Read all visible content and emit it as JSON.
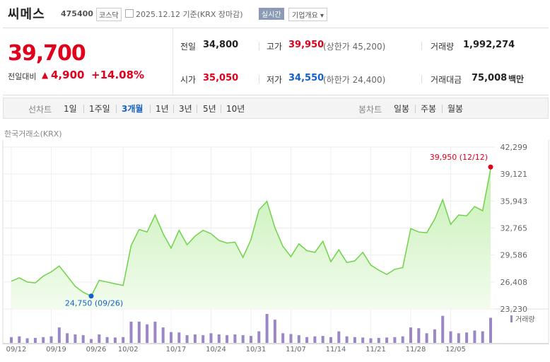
{
  "header": {
    "name": "씨메스",
    "code": "475400",
    "market": "코스닥",
    "date": "2025.12.12 기준(KRX 장마감)",
    "realtime": "실시간",
    "company_overview": "기업개요 ▾"
  },
  "quote": {
    "price": "39,700",
    "change_label": "전일대비",
    "change_arrow": "▲",
    "change": "4,900",
    "change_pct": "+14.08%",
    "prev_label": "전일",
    "prev": "34,800",
    "high_label": "고가",
    "high": "39,950",
    "upper_limit": "(상한가 45,200)",
    "volume_label": "거래량",
    "volume": "1,992,274",
    "open_label": "시가",
    "open": "35,050",
    "low_label": "저가",
    "low": "34,550",
    "lower_limit": "(하한가 24,400)",
    "amount_label": "거래대금",
    "amount": "75,008",
    "amount_unit": "백만"
  },
  "periods": {
    "line_label": "선차트",
    "line_items": [
      "1일",
      "1주일",
      "3개월",
      "1년",
      "3년",
      "5년",
      "10년"
    ],
    "active_index": 2,
    "candle_label": "봉차트",
    "candle_items": [
      "일봉",
      "주봉",
      "월봉"
    ]
  },
  "chart_label": "한국거래소(KRX)",
  "chart_data": {
    "type": "area",
    "y_ticks": [
      "42,299",
      "39,121",
      "35,943",
      "32,765",
      "29,586",
      "26,408",
      "23,230"
    ],
    "ylim": [
      23230,
      42299
    ],
    "x_ticks": [
      "09/12",
      "09/19",
      "09/26",
      "10/02",
      "10/17",
      "10/24",
      "10/31",
      "11/07",
      "11/14",
      "11/21",
      "11/28",
      "12/05"
    ],
    "price_values": [
      26500,
      26900,
      26400,
      26300,
      27100,
      27600,
      28300,
      27100,
      25900,
      25200,
      24750,
      26600,
      26400,
      26200,
      26000,
      30700,
      32600,
      32300,
      34300,
      32100,
      30400,
      32500,
      30800,
      31800,
      32500,
      32100,
      31300,
      31000,
      31100,
      29300,
      31400,
      34900,
      35900,
      32800,
      30600,
      29400,
      30900,
      30100,
      29900,
      31200,
      28800,
      30200,
      28700,
      28900,
      29900,
      28400,
      27800,
      27300,
      27900,
      28100,
      32700,
      32300,
      32200,
      33800,
      36100,
      33200,
      34300,
      34200,
      35300,
      34800,
      39700
    ],
    "high_marker": "39,950 (12/12)",
    "low_marker": "24,750 (09/26)",
    "volume_legend": "거래량",
    "volume_values": [
      0.15,
      0.17,
      0.12,
      0.13,
      0.15,
      0.17,
      0.4,
      0.25,
      0.22,
      0.2,
      0.1,
      0.22,
      0.15,
      0.14,
      0.15,
      0.55,
      0.55,
      0.48,
      0.55,
      0.4,
      0.28,
      0.27,
      0.2,
      0.22,
      0.2,
      0.25,
      0.22,
      0.2,
      0.22,
      0.2,
      0.18,
      0.3,
      0.75,
      0.6,
      0.25,
      0.23,
      0.2,
      0.15,
      0.17,
      0.18,
      0.15,
      0.3,
      0.17,
      0.15,
      0.14,
      0.12,
      0.13,
      0.14,
      0.15,
      0.17,
      0.4,
      0.38,
      0.25,
      0.35,
      0.7,
      0.3,
      0.25,
      0.27,
      0.32,
      0.3,
      0.65
    ]
  },
  "colors": {
    "up": "#e0001b",
    "down": "#1561c8",
    "line": "#6fd34a",
    "volume": "#9b86c6"
  }
}
